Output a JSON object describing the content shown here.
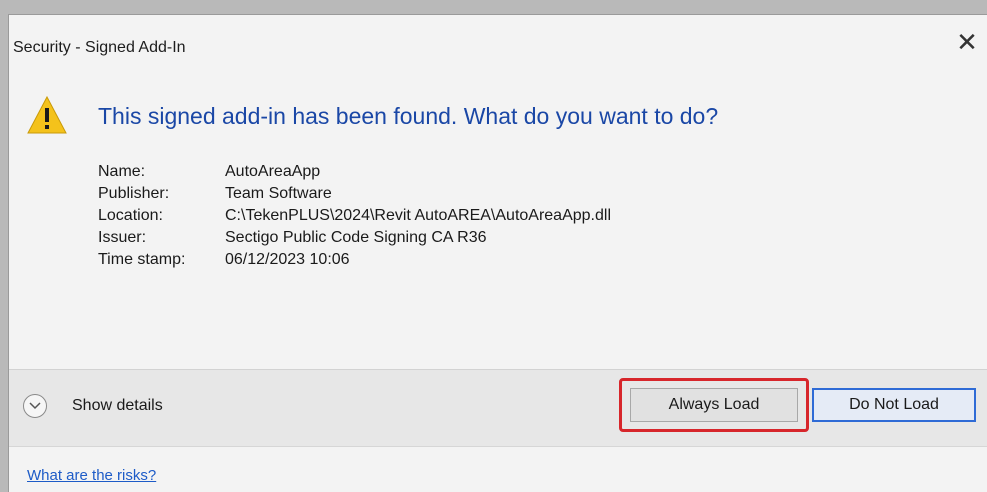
{
  "window": {
    "title": "Security - Signed Add-In",
    "close_glyph": "✕"
  },
  "message": {
    "headline": "This signed add-in has been found. What do you want to do?",
    "icon": "warning-icon"
  },
  "details": [
    {
      "label": "Name:",
      "value": "AutoAreaApp"
    },
    {
      "label": "Publisher:",
      "value": "Team Software"
    },
    {
      "label": "Location:",
      "value": "C:\\TekenPLUS\\2024\\Revit AutoAREA\\AutoAreaApp.dll"
    },
    {
      "label": "Issuer:",
      "value": "Sectigo Public Code Signing CA R36"
    },
    {
      "label": "Time stamp:",
      "value": "06/12/2023 10:06"
    }
  ],
  "footer": {
    "show_details_label": "Show details",
    "always_load_label": "Always Load",
    "do_not_load_label": "Do Not Load",
    "risks_link": "What are the risks?"
  },
  "colors": {
    "headline": "#1a47a6",
    "highlight_box": "#d7262b",
    "default_button_border": "#2f6bd6",
    "warning_yellow": "#f4c21b"
  }
}
